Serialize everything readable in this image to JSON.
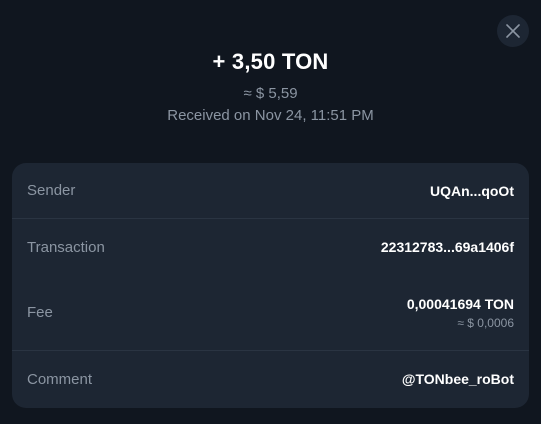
{
  "header": {
    "amount": "+ 3,50 TON",
    "fiat": "≈ $ 5,59",
    "received": "Received on Nov 24, 11:51 PM"
  },
  "close_icon": "close-icon",
  "details": {
    "sender": {
      "label": "Sender",
      "value": "UQAn...qoOt"
    },
    "transaction": {
      "label": "Transaction",
      "value": "22312783...69a1406f"
    },
    "fee": {
      "label": "Fee",
      "value": "0,00041694 TON",
      "fiat": "≈ $ 0,0006"
    },
    "comment": {
      "label": "Comment",
      "value": "@TONbee_roBot"
    }
  },
  "colors": {
    "background": "#10161f",
    "card": "#1d2633",
    "text_primary": "#ffffff",
    "text_secondary": "#8b95a2"
  }
}
